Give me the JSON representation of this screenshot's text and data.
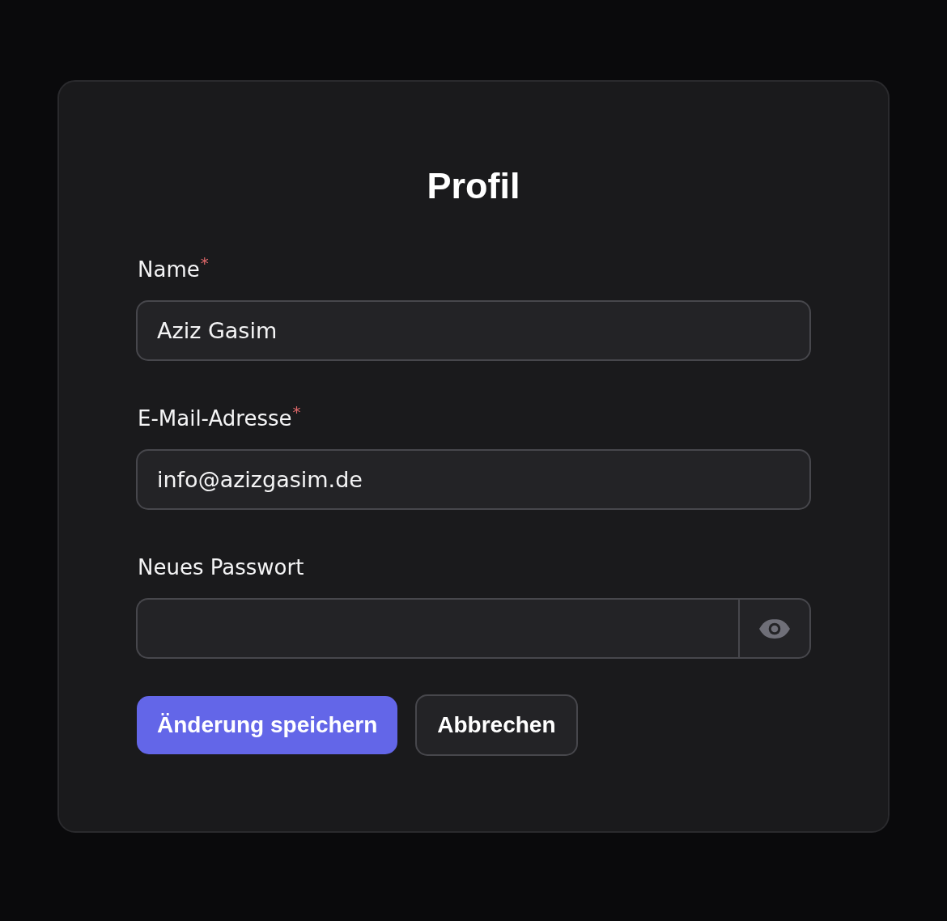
{
  "card": {
    "title": "Profil"
  },
  "fields": [
    {
      "kind": "text",
      "label": "Name",
      "required_mark": "*",
      "value": "Aziz Gasim"
    },
    {
      "kind": "email",
      "label": "E-Mail-Adresse",
      "required_mark": "*",
      "value": "info@azizgasim.de"
    },
    {
      "kind": "password",
      "label": "Neues Passwort"
    }
  ],
  "buttons": [
    {
      "kind": "primary",
      "label": "Änderung speichern"
    },
    {
      "kind": "secondary",
      "label": "Abbrechen"
    }
  ]
}
